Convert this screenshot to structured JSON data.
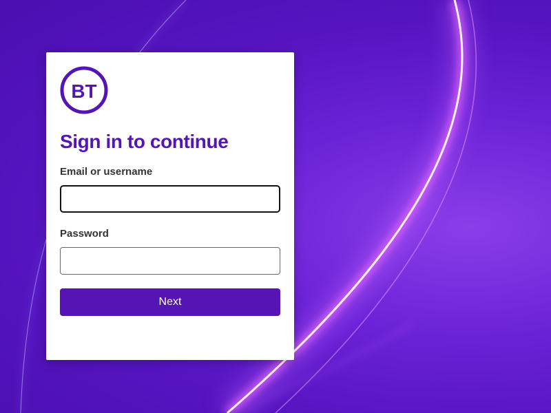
{
  "brand": {
    "logo_text": "BT",
    "primary_color": "#5514b4"
  },
  "login": {
    "heading": "Sign in to continue",
    "email_label": "Email or username",
    "email_value": "",
    "email_placeholder": "",
    "password_label": "Password",
    "password_value": "",
    "password_placeholder": "",
    "next_label": "Next"
  },
  "background": {
    "base_color": "#5514c0",
    "glow_color": "#f3c8ff"
  }
}
